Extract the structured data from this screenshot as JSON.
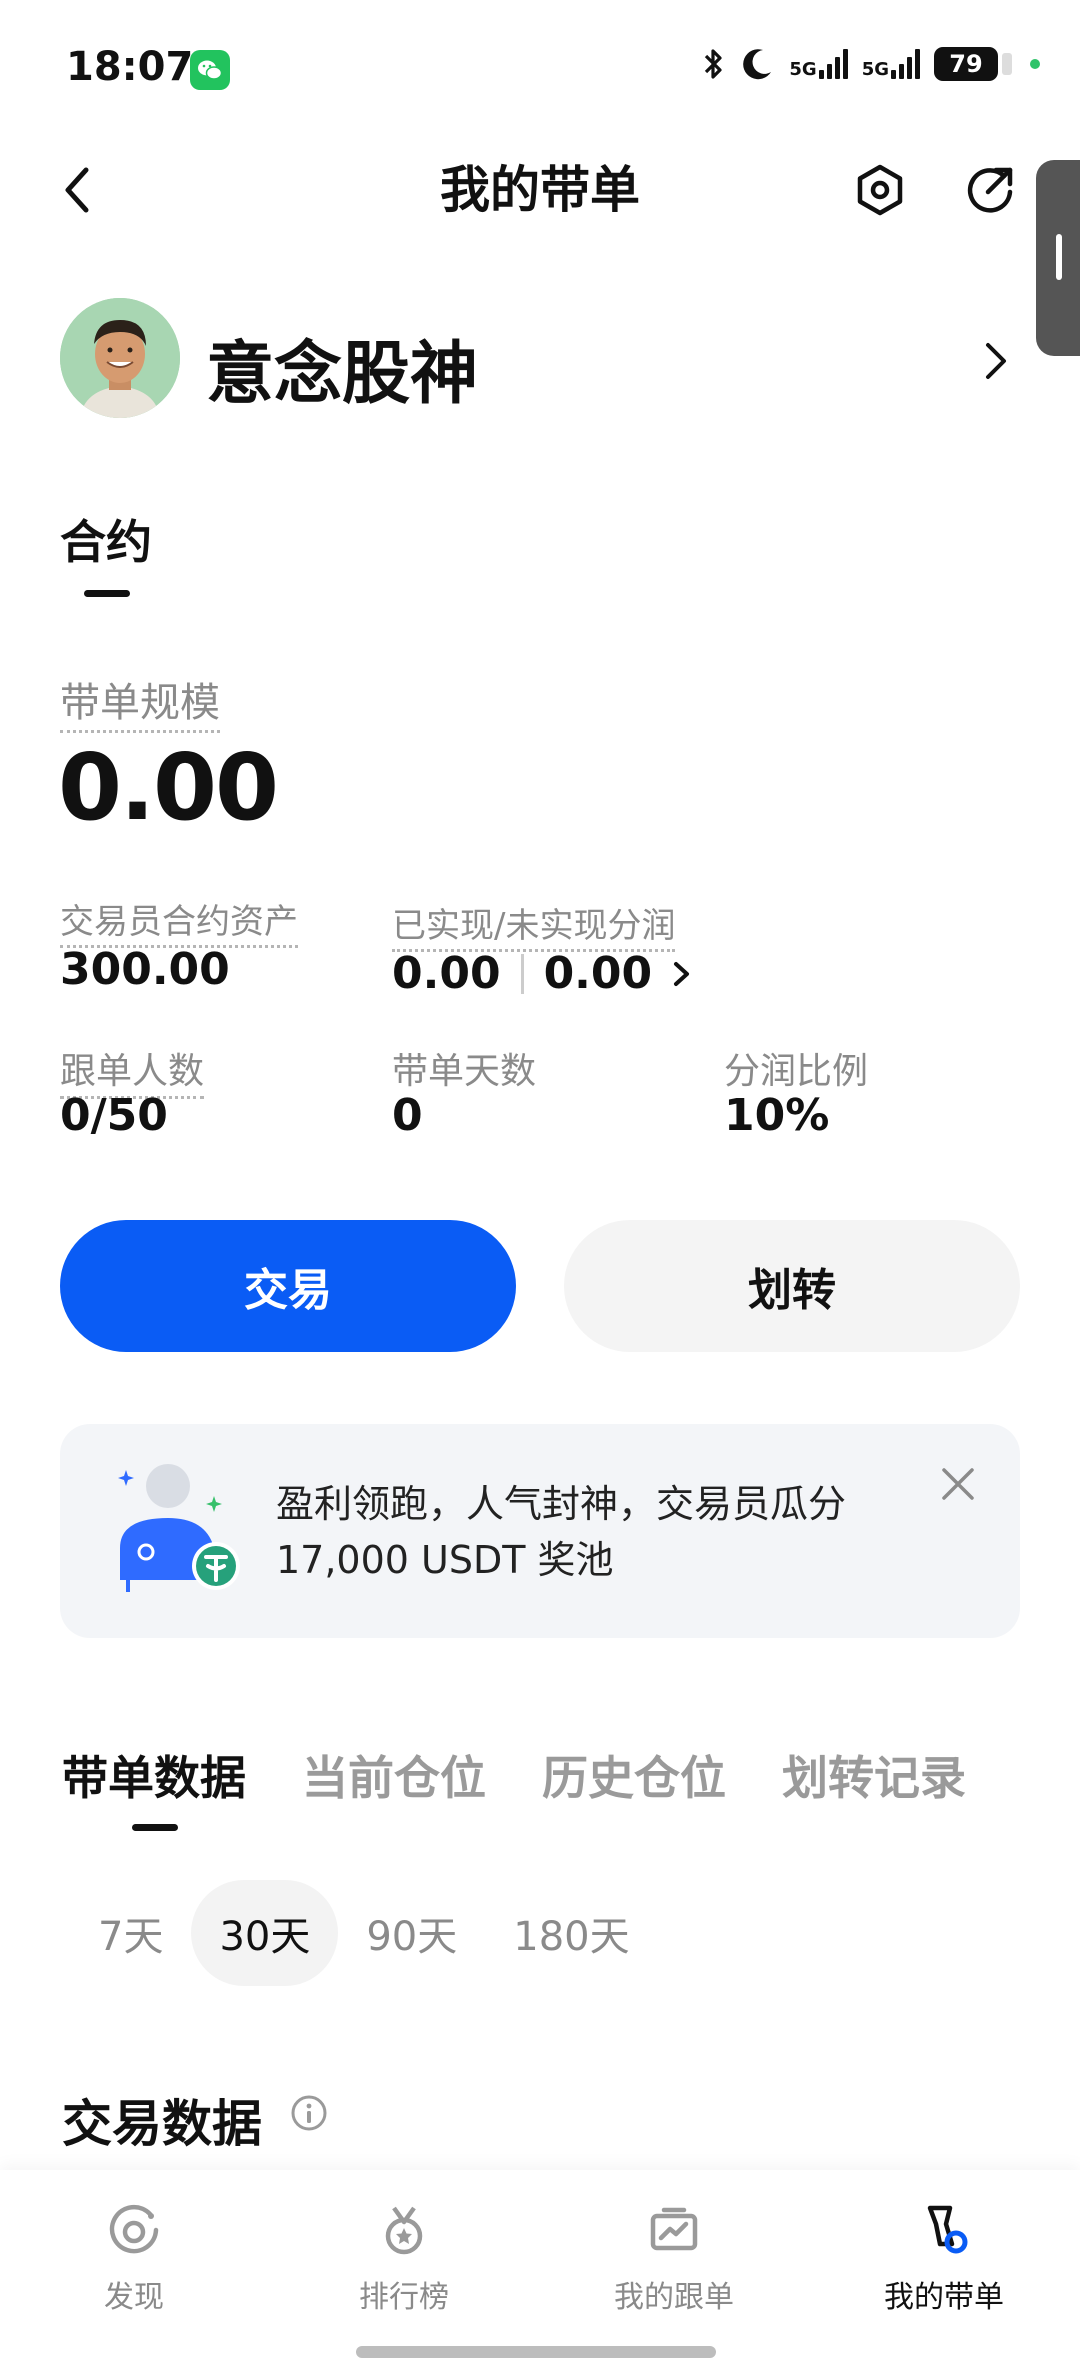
{
  "status_bar": {
    "time": "18:07",
    "network_1": "5G",
    "network_2": "5G",
    "battery": "79",
    "icons": [
      "wechat-icon",
      "bluetooth-icon",
      "moon-icon",
      "signal-icon",
      "battery-icon"
    ]
  },
  "header": {
    "title": "我的带单",
    "back_icon": "chevron-left-icon",
    "settings_icon": "hexagon-settings-icon",
    "share_icon": "share-icon"
  },
  "profile": {
    "name": "意念股神"
  },
  "tabs": {
    "contract": "合约"
  },
  "stats": {
    "scale_label": "带单规模",
    "scale_value": "0.00",
    "asset_label": "交易员合约资产",
    "asset_value": "300.00",
    "profit_label": "已实现/未实现分润",
    "realized": "0.00",
    "unrealized": "0.00",
    "followers_label": "跟单人数",
    "followers_value": "0/50",
    "days_label": "带单天数",
    "days_value": "0",
    "ratio_label": "分润比例",
    "ratio_value": "10%"
  },
  "actions": {
    "trade": "交易",
    "transfer": "划转"
  },
  "promo": {
    "line1": "盈利领跑，人气封神，交易员瓜分",
    "line2": "17,000 USDT 奖池"
  },
  "data_tabs": [
    "带单数据",
    "当前仓位",
    "历史仓位",
    "划转记录"
  ],
  "periods": [
    "7天",
    "30天",
    "90天",
    "180天"
  ],
  "active_period": "30天",
  "trade_data_title": "交易数据",
  "bottom_nav": [
    "发现",
    "排行榜",
    "我的跟单",
    "我的带单"
  ],
  "colors": {
    "accent": "#0a5cf5",
    "text": "#111111",
    "muted": "#8a8a8a",
    "wechat": "#22c35e",
    "tether": "#26a17b"
  }
}
